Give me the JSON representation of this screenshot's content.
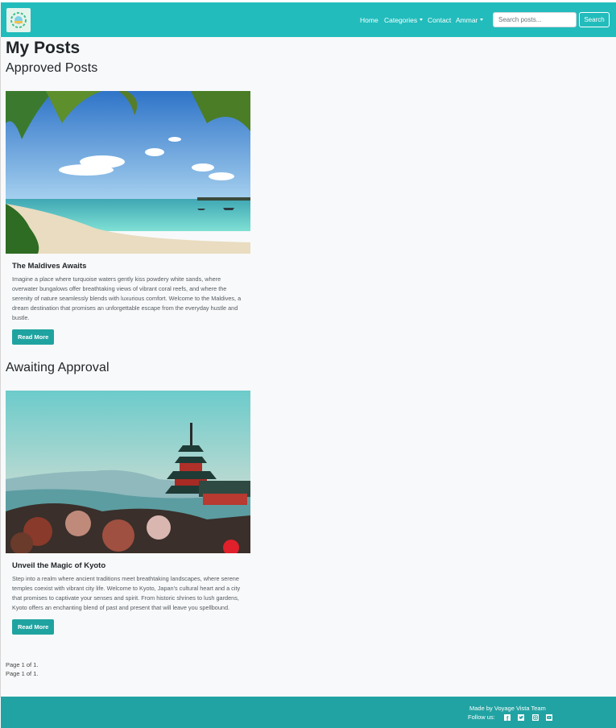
{
  "nav": {
    "logo": "logo-icon",
    "home": "Home",
    "categories": "Categories",
    "contact": "Contact",
    "user": "Ammar",
    "search_placeholder": "Search posts...",
    "search_button": "Search"
  },
  "page": {
    "title": "My Posts",
    "approved_heading": "Approved Posts",
    "awaiting_heading": "Awaiting Approval"
  },
  "approved_posts": [
    {
      "title": "The Maldives Awaits",
      "text": "Imagine a place where turquoise waters gently kiss powdery white sands, where overwater bungalows offer breathtaking views of vibrant coral reefs, and where the serenity of nature seamlessly blends with luxurious comfort. Welcome to the Maldives, a dream destination that promises an unforgettable escape from the everyday hustle and bustle.",
      "button": "Read More"
    }
  ],
  "awaiting_posts": [
    {
      "title": "Unveil the Magic of Kyoto",
      "text": "Step into a realm where ancient traditions meet breathtaking landscapes, where serene temples coexist with vibrant city life. Welcome to Kyoto, Japan's cultural heart and a city that promises to captivate your senses and spirit. From historic shrines to lush gardens, Kyoto offers an enchanting blend of past and present that will leave you spellbound.",
      "button": "Read More"
    }
  ],
  "pagination": {
    "approved": "Page 1 of 1.",
    "awaiting": "Page 1 of 1."
  },
  "footer": {
    "made_by": "Made by Voyage Vista Team",
    "follow": "Follow us:",
    "icons": [
      "facebook-icon",
      "twitter-icon",
      "instagram-icon",
      "youtube-icon"
    ]
  },
  "colors": {
    "navbar": "#22bcbc",
    "footer": "#22a3a3",
    "button": "#1fa3a0",
    "background": "#f8f9fa"
  }
}
